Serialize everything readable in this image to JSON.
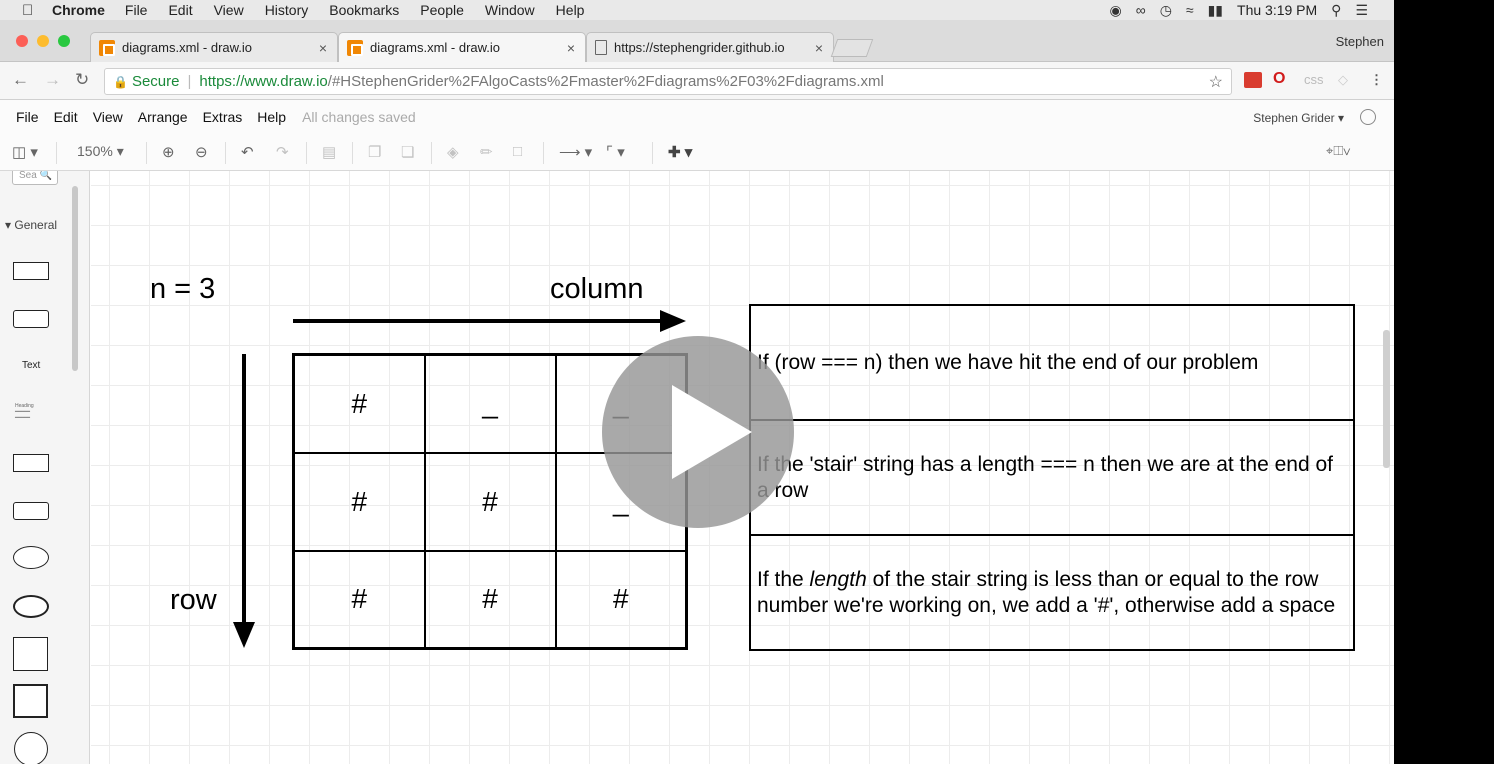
{
  "mac_menubar": {
    "apple_icon": "apple-icon",
    "app_name": "Chrome",
    "items": [
      "File",
      "Edit",
      "View",
      "History",
      "Bookmarks",
      "People",
      "Window",
      "Help"
    ],
    "clock": "Thu 3:19 PM"
  },
  "tabs": [
    {
      "title": "diagrams.xml - draw.io",
      "close": "×"
    },
    {
      "title": "diagrams.xml - draw.io",
      "close": "×"
    },
    {
      "title": "https://stephengrider.github.io",
      "close": "×"
    }
  ],
  "profile_name": "Stephen",
  "address": {
    "secure": "Secure",
    "url_host": "https://www.draw.io",
    "url_rest": "/#HStephenGrider%2FAlgoCasts%2Fmaster%2Fdiagrams%2F03%2Fdiagrams.xml",
    "ext_css": "css"
  },
  "drawio_menu": {
    "items": [
      "File",
      "Edit",
      "View",
      "Arrange",
      "Extras",
      "Help"
    ],
    "status": "All changes saved",
    "user": "Stephen Grider"
  },
  "toolbar": {
    "zoom": "150%"
  },
  "sidebar": {
    "search_placeholder": "Sea",
    "section": "General",
    "text_shape": "Text",
    "heading_shape": "Heading"
  },
  "diagram": {
    "n_label": "n = 3",
    "column_label": "column",
    "row_label": "row",
    "grid": [
      [
        "#",
        "_",
        "_"
      ],
      [
        "#",
        "#",
        "_"
      ],
      [
        "#",
        "#",
        "#"
      ]
    ],
    "rules": {
      "rule1": "If (row === n) then we have hit the end of our problem",
      "rule2": "If the 'stair' string has a length === n then we are at the end of a row",
      "rule3_pre": "If the ",
      "rule3_em": "length",
      "rule3_post": " of the stair string is less than or equal to the row number we're working on, we add a '#', otherwise add a space"
    }
  }
}
